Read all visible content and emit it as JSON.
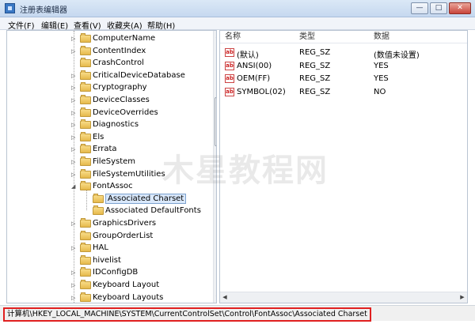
{
  "window": {
    "title": "注册表编辑器",
    "controls": {
      "minimize": "—",
      "maximize": "□",
      "close": "✕"
    }
  },
  "menu": [
    {
      "label": "文件(F)"
    },
    {
      "label": "编辑(E)"
    },
    {
      "label": "查看(V)"
    },
    {
      "label": "收藏夹(A)"
    },
    {
      "label": "帮助(H)"
    }
  ],
  "tree": {
    "items": [
      {
        "label": "ComputerName",
        "expander": "▷"
      },
      {
        "label": "ContentIndex",
        "expander": "▷"
      },
      {
        "label": "CrashControl",
        "expander": ""
      },
      {
        "label": "CriticalDeviceDatabase",
        "expander": "▷"
      },
      {
        "label": "Cryptography",
        "expander": "▷"
      },
      {
        "label": "DeviceClasses",
        "expander": "▷"
      },
      {
        "label": "DeviceOverrides",
        "expander": "▷"
      },
      {
        "label": "Diagnostics",
        "expander": "▷"
      },
      {
        "label": "Els",
        "expander": "▷"
      },
      {
        "label": "Errata",
        "expander": "▷"
      },
      {
        "label": "FileSystem",
        "expander": "▷"
      },
      {
        "label": "FileSystemUtilities",
        "expander": "▷"
      },
      {
        "label": "FontAssoc",
        "expander": "◢"
      },
      {
        "label": "Associated Charset",
        "expander": "",
        "child": true,
        "selected": true
      },
      {
        "label": "Associated DefaultFonts",
        "expander": "",
        "child": true
      },
      {
        "label": "GraphicsDrivers",
        "expander": "▷"
      },
      {
        "label": "GroupOrderList",
        "expander": ""
      },
      {
        "label": "HAL",
        "expander": "▷"
      },
      {
        "label": "hivelist",
        "expander": ""
      },
      {
        "label": "IDConfigDB",
        "expander": "▷"
      },
      {
        "label": "Keyboard Layout",
        "expander": "▷"
      },
      {
        "label": "Keyboard Layouts",
        "expander": "▷"
      }
    ]
  },
  "values": {
    "columns": {
      "name": "名称",
      "type": "类型",
      "data": "数据"
    },
    "rows": [
      {
        "name": "(默认)",
        "type": "REG_SZ",
        "data": "(数值未设置)"
      },
      {
        "name": "ANSI(00)",
        "type": "REG_SZ",
        "data": "YES"
      },
      {
        "name": "OEM(FF)",
        "type": "REG_SZ",
        "data": "YES"
      },
      {
        "name": "SYMBOL(02)",
        "type": "REG_SZ",
        "data": "NO"
      }
    ],
    "value_icon_label": "ab"
  },
  "status": {
    "path": "计算机\\HKEY_LOCAL_MACHINE\\SYSTEM\\CurrentControlSet\\Control\\FontAssoc\\Associated Charset"
  },
  "watermark": "木星教程网",
  "colors": {
    "selection": "#d9e8fb",
    "status_highlight": "#e02020",
    "folder": "#e6b94b"
  }
}
